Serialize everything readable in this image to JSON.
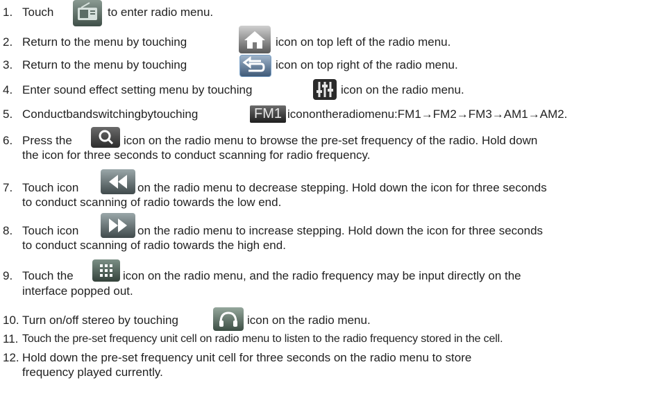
{
  "items": [
    {
      "num": "1.",
      "before": "Touch",
      "after": "to enter radio menu."
    },
    {
      "num": "2.",
      "before": "Return to the menu by touching",
      "after": "icon on top left of the radio menu."
    },
    {
      "num": "3.",
      "before": "Return to the menu by touching",
      "after": "icon on top right of the radio menu."
    },
    {
      "num": "4.",
      "before": "Enter sound effect setting menu by touching",
      "after": "icon on the radio menu."
    },
    {
      "num": "5.",
      "before": "Conductbandswitchingbytouching",
      "icon_text": "FM1",
      "after": "iconontheradiomenu:FM1→FM2→FM3→AM1→AM2."
    },
    {
      "num": "6.",
      "before": "Press the",
      "after": "icon on the radio menu to browse the pre-set frequency of the radio. Hold down",
      "line2": "the icon for three seconds to conduct scanning for radio frequency."
    },
    {
      "num": "7.",
      "before": "Touch icon",
      "after": "on the radio menu to decrease stepping. Hold down the icon for three seconds",
      "line2": "to conduct scanning of radio towards the low end."
    },
    {
      "num": "8.",
      "before": "Touch icon",
      "after": "on the radio menu to increase stepping. Hold down the icon for three seconds",
      "line2": "to conduct scanning of radio towards the high end."
    },
    {
      "num": "9.",
      "before": "Touch the",
      "after": "icon on the radio menu, and the radio frequency may be input directly on the",
      "line2": "interface popped out."
    },
    {
      "num": "10.",
      "before": "Turn on/off stereo by touching",
      "after": "icon on the radio menu."
    },
    {
      "num": "11.",
      "text": "Touch the pre-set frequency unit cell on radio menu to listen to the radio frequency stored in the cell."
    },
    {
      "num": "12.",
      "text": "Hold down the pre-set frequency unit cell for three seconds on the radio menu to store",
      "line2": "frequency played currently."
    }
  ],
  "icons": [
    "radio-icon",
    "home-icon",
    "back-arrow-icon",
    "equalizer-icon",
    "fm1-band-icon",
    "search-icon",
    "rewind-icon",
    "fast-forward-icon",
    "keypad-icon",
    "headphones-stereo-icon"
  ]
}
